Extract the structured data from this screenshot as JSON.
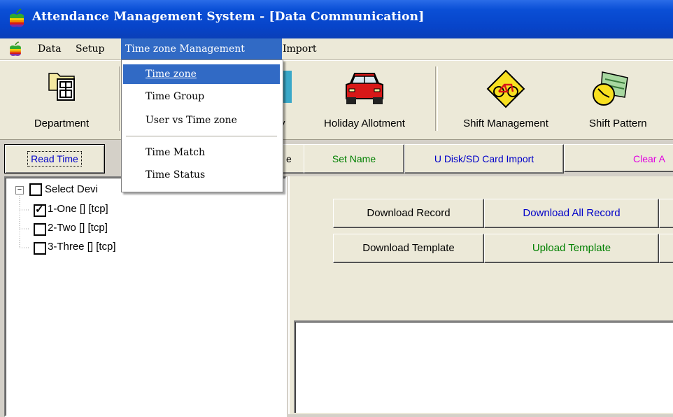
{
  "window": {
    "title": "Attendance Management System - [Data Communication]"
  },
  "menubar": {
    "items": [
      "Data",
      "Setup",
      "Time zone Management",
      "Import"
    ],
    "active": "Time zone Management"
  },
  "dropdown": {
    "items": [
      "Time zone",
      "Time Group",
      "User vs Time zone",
      "Time Match",
      "Time Status"
    ],
    "highlighted": "Time zone"
  },
  "toolbar": {
    "department": "Department",
    "holiday_partial": "y",
    "holiday_allotment": "Holiday Allotment",
    "shift_management": "Shift Management",
    "shift_pattern": "Shift Pattern"
  },
  "actions": {
    "read_time": "Read Time",
    "partial": "e",
    "set_name": "Set Name",
    "usb_import": "U Disk/SD Card Import",
    "clear": "Clear A"
  },
  "tree": {
    "root": "Select Devi",
    "devices": [
      {
        "label": "1-One   []   [tcp]",
        "checked": true
      },
      {
        "label": "2-Two   []   [tcp]",
        "checked": false
      },
      {
        "label": "3-Three   []   [tcp]",
        "checked": false
      }
    ]
  },
  "download": {
    "download_record": "Download Record",
    "download_all_record": "Download All Record",
    "download_template": "Download Template",
    "upload_template": "Upload Template"
  },
  "colors": {
    "titlebar": "#0a4fd6",
    "menu_highlight": "#316ac5",
    "read_time_text": "#0000c8",
    "set_name_text": "#008000",
    "usb_text": "#0000c8",
    "clear_text": "#e000e0",
    "download_all_text": "#0000c8",
    "upload_template_text": "#008000"
  }
}
